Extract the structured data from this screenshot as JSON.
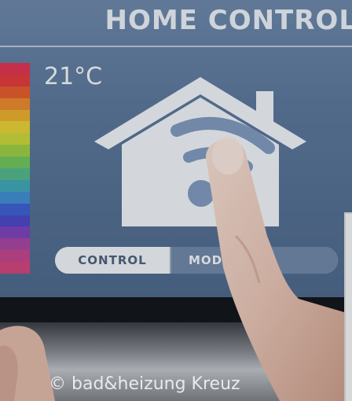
{
  "screen": {
    "title": "HOME CONTROL",
    "temperature": "21°C"
  },
  "buttons": {
    "control_label": "CONTROL",
    "mode_label": "MODE"
  },
  "color_scale": [
    "#e0334f",
    "#e23a3a",
    "#e45a2a",
    "#e8892a",
    "#e9ad2c",
    "#e6cf33",
    "#c9d43a",
    "#9ccc43",
    "#6fc35a",
    "#52b58a",
    "#3fa6b4",
    "#3f8ccf",
    "#3c5fd0",
    "#4a46c4",
    "#7a43b8",
    "#a7449f",
    "#c2448a",
    "#d0447a"
  ],
  "watermark": "© bad&heizung Kreuz"
}
